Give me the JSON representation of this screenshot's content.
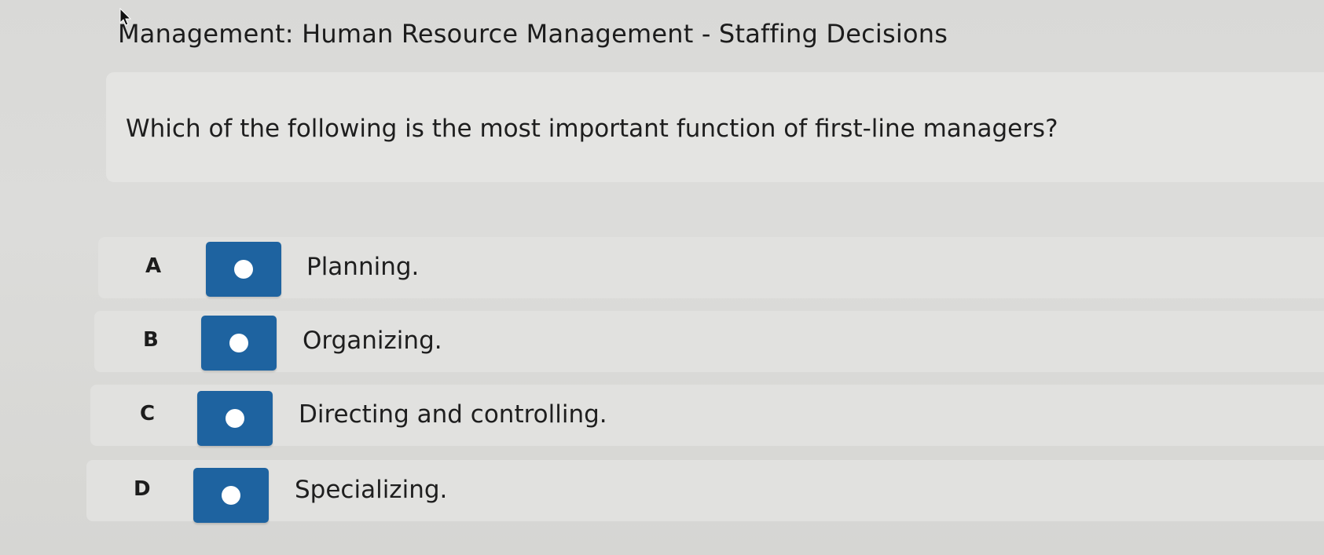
{
  "header": {
    "title": "Management: Human Resource Management - Staffing Decisions"
  },
  "question": {
    "text": "Which of the following is the most important function of first-line managers?"
  },
  "options": [
    {
      "letter": "A",
      "text": "Planning."
    },
    {
      "letter": "B",
      "text": "Organizing."
    },
    {
      "letter": "C",
      "text": "Directing and controlling."
    },
    {
      "letter": "D",
      "text": "Specializing."
    }
  ],
  "colors": {
    "radio_box": "#1e63a0",
    "radio_dot": "#ffffff",
    "background": "#d9d9d7",
    "panel": "#e4e4e2"
  },
  "icons": {
    "cursor": "mouse-pointer-icon",
    "radio": "radio-unselected-icon"
  }
}
